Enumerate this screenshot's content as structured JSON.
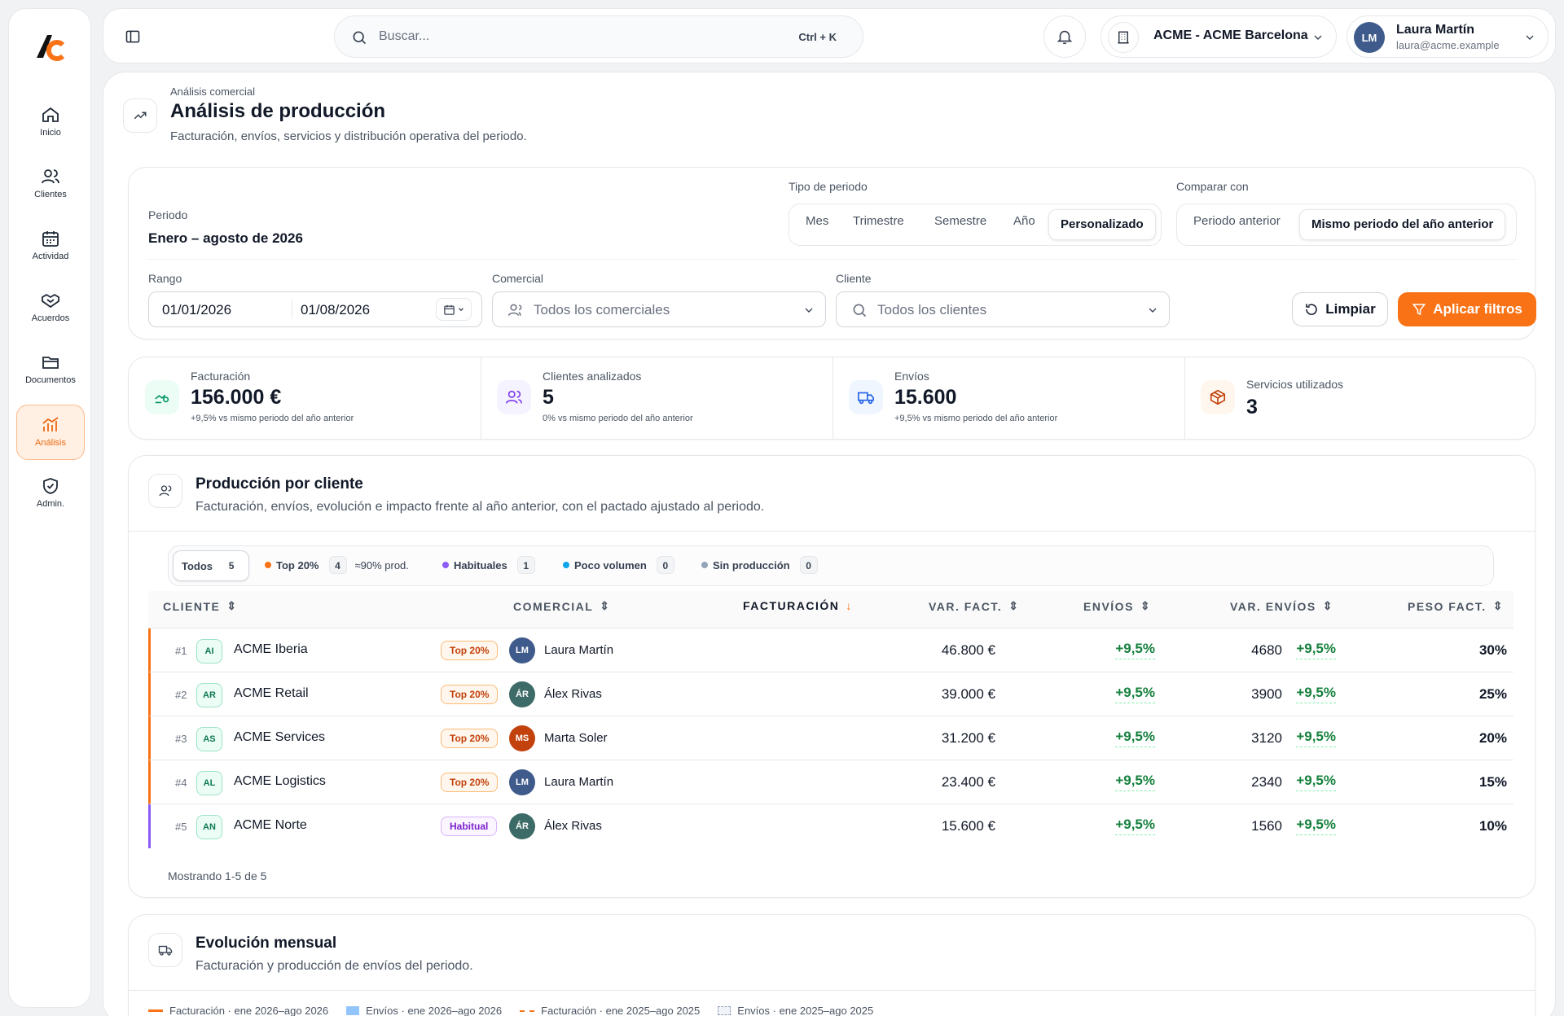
{
  "nav": {
    "items": [
      {
        "label": "Inicio",
        "icon": "home-icon"
      },
      {
        "label": "Clientes",
        "icon": "users-icon"
      },
      {
        "label": "Actividad",
        "icon": "calendar-icon"
      },
      {
        "label": "Acuerdos",
        "icon": "handshake-icon"
      },
      {
        "label": "Documentos",
        "icon": "folder-icon"
      },
      {
        "label": "Análisis",
        "icon": "chart-icon",
        "active": true
      },
      {
        "label": "Admin.",
        "icon": "shield-icon"
      }
    ]
  },
  "topbar": {
    "search_placeholder": "Buscar...",
    "search_shortcut": "Ctrl + K",
    "company": "ACME - ACME Barcelona",
    "user": {
      "initials": "LM",
      "name": "Laura Martín",
      "email": "laura@acme.example"
    }
  },
  "page": {
    "breadcrumb": "Análisis comercial",
    "title": "Análisis de producción",
    "subtitle": "Facturación, envíos, servicios y distribución operativa del periodo."
  },
  "filters": {
    "period_label": "Periodo",
    "period_value": "Enero – agosto de 2026",
    "period_type_label": "Tipo de periodo",
    "period_types": [
      "Mes",
      "Trimestre",
      "Semestre",
      "Año",
      "Personalizado"
    ],
    "period_type_selected": "Personalizado",
    "compare_label": "Comparar con",
    "compare_options": [
      "Periodo anterior",
      "Mismo periodo del año anterior"
    ],
    "compare_selected": "Mismo periodo del año anterior",
    "range_label": "Rango",
    "range_start": "01/01/2026",
    "range_end": "01/08/2026",
    "sales_label": "Comercial",
    "sales_placeholder": "Todos los comerciales",
    "client_label": "Cliente",
    "client_placeholder": "Todos los clientes",
    "clear_label": "Limpiar",
    "apply_label": "Aplicar filtros"
  },
  "kpis": [
    {
      "label": "Facturación",
      "value": "156.000 €",
      "note": "+9,5% vs mismo periodo del año anterior",
      "icon": "money-icon"
    },
    {
      "label": "Clientes analizados",
      "value": "5",
      "note": "0% vs mismo periodo del año anterior",
      "icon": "users-icon"
    },
    {
      "label": "Envíos",
      "value": "15.600",
      "note": "+9,5% vs mismo periodo del año anterior",
      "icon": "truck-icon"
    },
    {
      "label": "Servicios utilizados",
      "value": "3",
      "note": "",
      "icon": "box-icon"
    }
  ],
  "production": {
    "title": "Producción por cliente",
    "subtitle": "Facturación, envíos, evolución e impacto frente al año anterior, con el pactado ajustado al periodo.",
    "chips": {
      "all": {
        "label": "Todos",
        "count": "5"
      },
      "top": {
        "label": "Top 20%",
        "count": "4",
        "extra": "≈90% prod."
      },
      "habitual": {
        "label": "Habituales",
        "count": "1"
      },
      "low": {
        "label": "Poco volumen",
        "count": "0"
      },
      "none": {
        "label": "Sin producción",
        "count": "0"
      }
    },
    "columns": {
      "client": "CLIENTE",
      "sales": "COMERCIAL",
      "billing": "FACTURACIÓN",
      "var_billing": "VAR. FACT.",
      "shipments": "ENVÍOS",
      "var_shipments": "VAR. ENVÍOS",
      "weight": "PESO FACT."
    },
    "rows": [
      {
        "rank": "#1",
        "initials": "AI",
        "client": "ACME Iberia",
        "tag": "Top 20%",
        "sales_initials": "LM",
        "sales": "Laura Martín",
        "billing": "46.800 €",
        "var_billing": "+9,5%",
        "shipments": "4680",
        "var_shipments": "+9,5%",
        "weight": "30%"
      },
      {
        "rank": "#2",
        "initials": "AR",
        "client": "ACME Retail",
        "tag": "Top 20%",
        "sales_initials": "ÁR",
        "sales": "Álex Rivas",
        "billing": "39.000 €",
        "var_billing": "+9,5%",
        "shipments": "3900",
        "var_shipments": "+9,5%",
        "weight": "25%"
      },
      {
        "rank": "#3",
        "initials": "AS",
        "client": "ACME Services",
        "tag": "Top 20%",
        "sales_initials": "MS",
        "sales": "Marta Soler",
        "billing": "31.200 €",
        "var_billing": "+9,5%",
        "shipments": "3120",
        "var_shipments": "+9,5%",
        "weight": "20%"
      },
      {
        "rank": "#4",
        "initials": "AL",
        "client": "ACME Logistics",
        "tag": "Top 20%",
        "sales_initials": "LM",
        "sales": "Laura Martín",
        "billing": "23.400 €",
        "var_billing": "+9,5%",
        "shipments": "2340",
        "var_shipments": "+9,5%",
        "weight": "15%"
      },
      {
        "rank": "#5",
        "initials": "AN",
        "client": "ACME Norte",
        "tag": "Habitual",
        "sales_initials": "ÁR",
        "sales": "Álex Rivas",
        "billing": "15.600 €",
        "var_billing": "+9,5%",
        "shipments": "1560",
        "var_shipments": "+9,5%",
        "weight": "10%"
      }
    ],
    "footer": "Mostrando 1-5 de 5"
  },
  "evolution": {
    "title": "Evolución mensual",
    "subtitle": "Facturación y producción de envíos del periodo.",
    "legend": [
      "Facturación · ene 2026–ago 2026",
      "Envíos · ene 2026–ago 2026",
      "Facturación · ene 2025–ago 2025",
      "Envíos · ene 2025–ago 2025"
    ]
  },
  "colors": {
    "accent": "#f97316",
    "positive": "#15803d",
    "habitual": "#8b5cf6",
    "low_volume": "#0ea5e9",
    "no_production": "#94a3b8"
  }
}
